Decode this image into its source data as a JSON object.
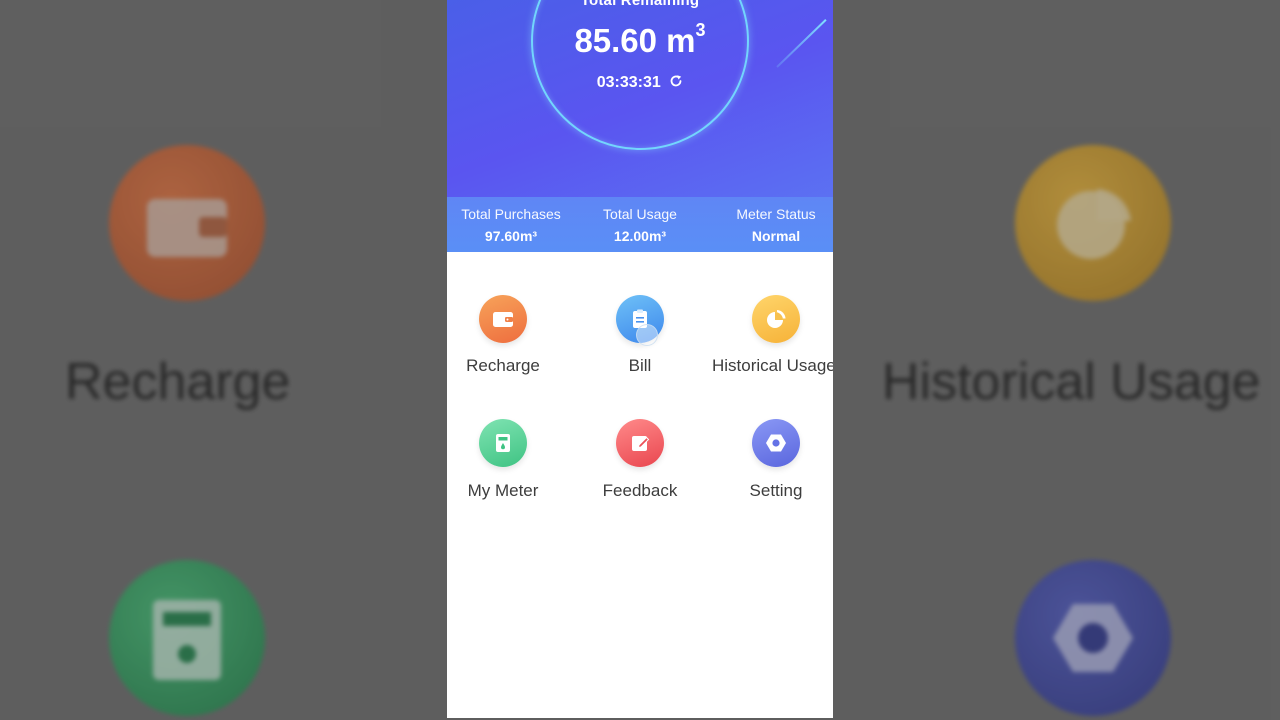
{
  "hero": {
    "label": "Total Remaining",
    "value": "85.60 m",
    "value_unit_sup": "3",
    "timer": "03:33:31"
  },
  "stats": [
    {
      "label": "Total Purchases",
      "value": "97.60m³"
    },
    {
      "label": "Total Usage",
      "value": "12.00m³"
    },
    {
      "label": "Meter Status",
      "value": "Normal"
    }
  ],
  "menu": [
    {
      "label": "Recharge",
      "icon": "wallet-icon",
      "color_start": "#f7a35a",
      "color_end": "#ee6d3e"
    },
    {
      "label": "Bill",
      "icon": "clipboard-icon",
      "color_start": "#6fc1f7",
      "color_end": "#3d87ec"
    },
    {
      "label": "Historical Usage",
      "icon": "pie-chart-icon",
      "color_start": "#ffd56b",
      "color_end": "#f6b238"
    },
    {
      "label": "My Meter",
      "icon": "meter-icon",
      "color_start": "#7fe3b2",
      "color_end": "#3fc383"
    },
    {
      "label": "Feedback",
      "icon": "edit-icon",
      "color_start": "#ff8a8a",
      "color_end": "#e9464f"
    },
    {
      "label": "Setting",
      "icon": "hex-nut-icon",
      "color_start": "#8a98f5",
      "color_end": "#5a66de"
    }
  ],
  "background": {
    "left_label": "Recharge",
    "right_label": "Historical Usage"
  }
}
